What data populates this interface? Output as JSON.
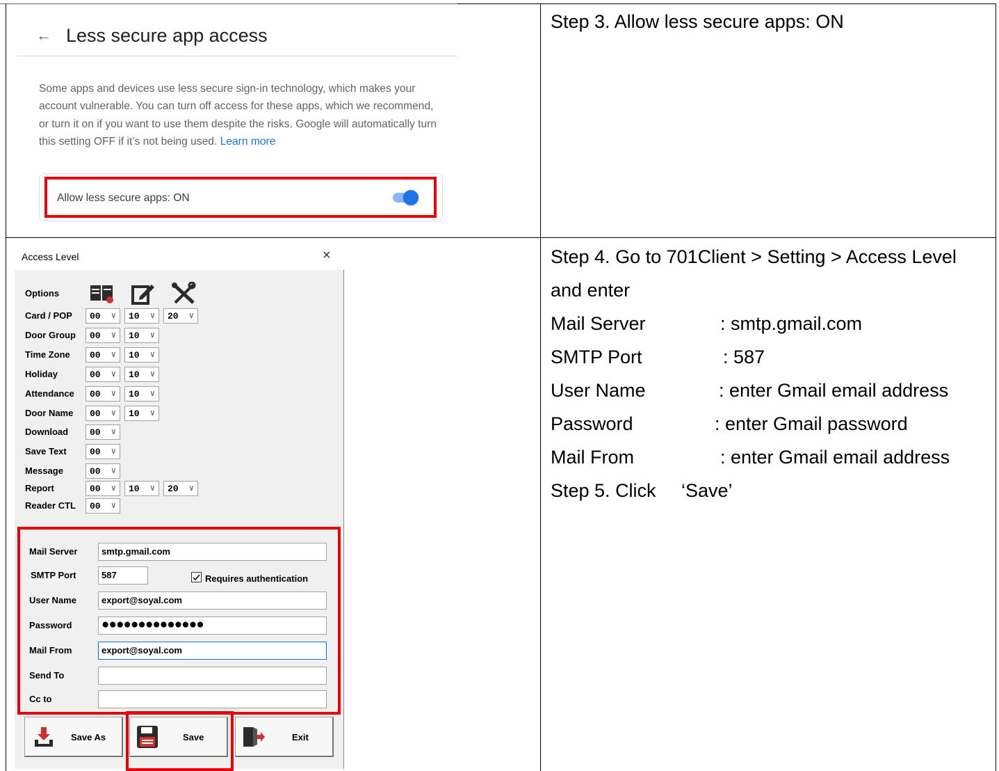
{
  "google": {
    "back_arrow": "←",
    "title": "Less secure app access",
    "description": "Some apps and devices use less secure sign-in technology, which makes your account vulnerable. You can turn off access for these apps, which we recommend, or turn it on if you want to use them despite the risks. Google will automatically turn this setting OFF if it’s not being used.",
    "learn_more": "Learn more",
    "toggle_label": "Allow less secure apps: ON",
    "toggle_on": true,
    "accent_color": "#1a73e8",
    "highlight_color": "#e8000b"
  },
  "steps": {
    "step3": "Step 3. Allow less secure apps: ON",
    "step4_line1": "Step 4. Go to 701Client > Setting > Access Level",
    "step4_line2": "and enter",
    "mail_server_label": "Mail Server",
    "mail_server_value": ": smtp.gmail.com",
    "smtp_port_label": "SMTP Port",
    "smtp_port_value": ": 587",
    "user_name_label": "User Name",
    "user_name_value": ": enter Gmail email address",
    "password_label": "Password",
    "password_value": ": enter Gmail password",
    "mail_from_label": "Mail From",
    "mail_from_value": ": enter Gmail email address",
    "step5": "Step 5. Click",
    "step5_target": "‘Save’"
  },
  "dialog": {
    "title": "Access Level",
    "close_icon": "×",
    "options_label": "Options",
    "icons": [
      "book-icon",
      "edit-icon",
      "tools-icon"
    ],
    "rows": [
      {
        "label": "Card / POP",
        "values": [
          "00",
          "10",
          "20"
        ]
      },
      {
        "label": "Door Group",
        "values": [
          "00",
          "10"
        ]
      },
      {
        "label": "Time Zone",
        "values": [
          "00",
          "10"
        ]
      },
      {
        "label": "Holiday",
        "values": [
          "00",
          "10"
        ]
      },
      {
        "label": "Attendance",
        "values": [
          "00",
          "10"
        ]
      },
      {
        "label": "Door Name",
        "values": [
          "00",
          "10"
        ]
      },
      {
        "label": "Download",
        "values": [
          "00"
        ]
      },
      {
        "label": "Save Text",
        "values": [
          "00"
        ]
      },
      {
        "label": "Message",
        "values": [
          "00"
        ]
      },
      {
        "label": "Report",
        "values": [
          "00",
          "10",
          "20"
        ]
      },
      {
        "label": "Reader CTL",
        "values": [
          "00"
        ]
      }
    ],
    "mail": {
      "mail_server_label": "Mail Server",
      "mail_server_value": "smtp.gmail.com",
      "smtp_port_label": "SMTP Port",
      "smtp_port_value": "587",
      "requires_auth_label": "Requires authentication",
      "requires_auth_checked": true,
      "user_name_label": "User Name",
      "user_name_value": "export@soyal.com",
      "password_label": "Password",
      "password_value": "●●●●●●●●●●●●●●",
      "mail_from_label": "Mail From",
      "mail_from_value": "export@soyal.com",
      "send_to_label": "Send To",
      "send_to_value": "",
      "cc_to_label": "Cc to",
      "cc_to_value": ""
    },
    "buttons": {
      "save_as": "Save As",
      "save": "Save",
      "exit": "Exit"
    }
  }
}
